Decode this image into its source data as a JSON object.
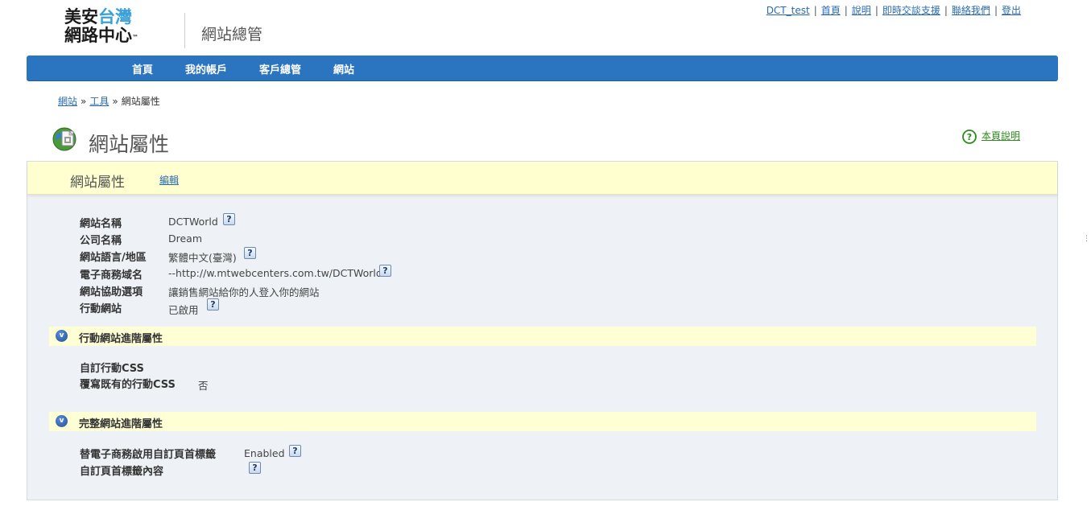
{
  "header": {
    "logo_line1_a": "美安",
    "logo_line1_b": "台灣",
    "logo_line2": "網路中心",
    "logo_tm": "™",
    "app_title": "網站總管",
    "top_links": [
      "DCT_test",
      "首頁",
      "說明",
      "即時交談支援",
      "聯絡我們",
      "登出"
    ],
    "separator": "|"
  },
  "nav": {
    "items": [
      "首頁",
      "我的帳戶",
      "客戶總管",
      "網站"
    ]
  },
  "breadcrumb": {
    "items": [
      "網站",
      "工具",
      "網站屬性"
    ],
    "separator": "»"
  },
  "page": {
    "title": "網站屬性",
    "help_label": "本頁說明",
    "help_icon": "question-circle-icon",
    "title_icon": "site-properties-icon"
  },
  "tabs": {
    "active": "網站屬性",
    "edit": "編輯"
  },
  "properties": [
    {
      "label": "網站名稱",
      "value": "DCTWorld",
      "help": true
    },
    {
      "label": "公司名稱",
      "value": "Dream",
      "help": false
    },
    {
      "label": "網站語言/地區",
      "value": "繁體中文(臺灣)",
      "help": true
    },
    {
      "label": "電子商務域名",
      "value": "--http://w.mtwebcenters.com.tw/DCTWorld--",
      "help": true
    },
    {
      "label": "網站協助選項",
      "value": "讓銷售網站給你的人登入你的網站",
      "help": false
    },
    {
      "label": "行動網站",
      "value": "已啟用",
      "help": true
    }
  ],
  "mobile_section": {
    "title": "行動網站進階屬性",
    "chevron": "v",
    "rows": [
      {
        "label": "自訂行動CSS",
        "value": ""
      },
      {
        "label": "覆寫既有的行動CSS",
        "value": "否"
      }
    ]
  },
  "full_section": {
    "title": "完整網站進階屬性",
    "chevron": "v",
    "rows": [
      {
        "label": "替電子商務啟用自訂頁首標籤",
        "value": "Enabled",
        "help": true
      },
      {
        "label": "自訂頁首標籤內容",
        "value": "",
        "help": true
      }
    ]
  },
  "help_glyph": "?",
  "colors": {
    "nav_bg": "#2b74c0",
    "tabbar_bg": "#ffffd0",
    "panel_bg": "#eef2f7",
    "link": "#2a6bb0",
    "help_link": "#2a8a1a"
  }
}
